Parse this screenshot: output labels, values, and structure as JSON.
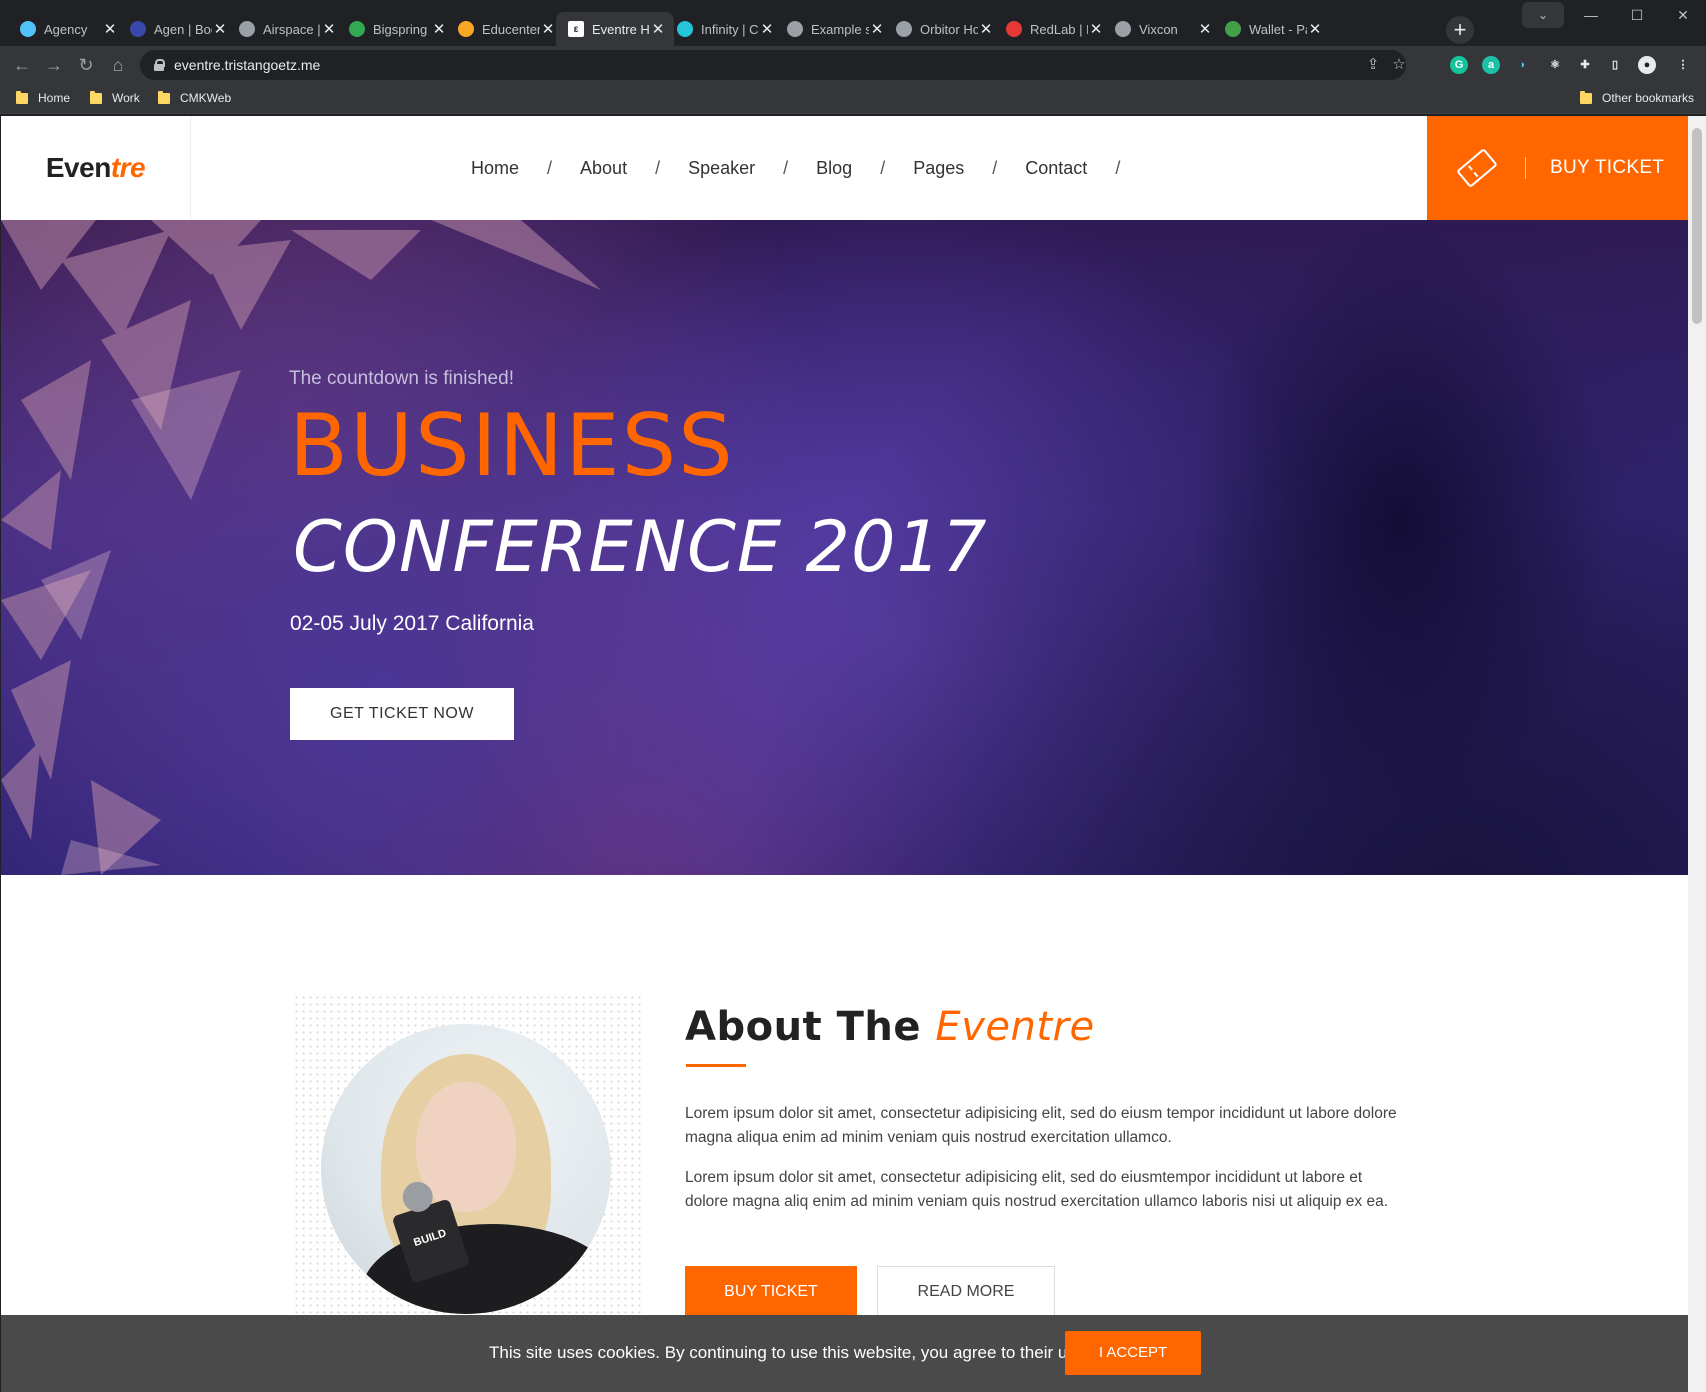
{
  "browser": {
    "tabs": [
      {
        "label": "Agency",
        "icon": "agency-icon",
        "color": "#4fc3f7"
      },
      {
        "label": "Agen | Boo",
        "icon": "map-pin-icon",
        "color": "#3949ab"
      },
      {
        "label": "Airspace |",
        "icon": "globe-icon",
        "color": "#9aa0a6"
      },
      {
        "label": "Bigspring",
        "icon": "bigspring-icon",
        "color": "#34a853"
      },
      {
        "label": "Educenter",
        "icon": "educenter-icon",
        "color": "#f9a825"
      },
      {
        "label": "Eventre Ho",
        "icon": "eventre-favicon",
        "color": "#ffffff"
      },
      {
        "label": "Infinity | C",
        "icon": "infinity-icon",
        "color": "#26c6da"
      },
      {
        "label": "Example s",
        "icon": "chart-line-icon",
        "color": "#9aa0a6"
      },
      {
        "label": "Orbitor Ho",
        "icon": "globe-icon",
        "color": "#9aa0a6"
      },
      {
        "label": "RedLab | B",
        "icon": "redlab-icon",
        "color": "#e53935"
      },
      {
        "label": "Vixcon",
        "icon": "globe-icon",
        "color": "#9aa0a6"
      },
      {
        "label": "Wallet - Pa",
        "icon": "wallet-icon",
        "color": "#43a047"
      }
    ],
    "active_tab": "Eventre Ho",
    "url": "eventre.tristangoetz.me",
    "bookmarks": [
      "Home",
      "Work",
      "CMKWeb"
    ],
    "other_bookmarks": "Other bookmarks"
  },
  "site": {
    "logo": {
      "part1": "Even",
      "part2": "tre"
    },
    "nav": [
      "Home",
      "About",
      "Speaker",
      "Blog",
      "Pages",
      "Contact"
    ],
    "nav_separator": "/",
    "buy_ticket": "BUY TICKET",
    "accent_color": "#ff6600",
    "hero": {
      "countdown": "The countdown is finished!",
      "title1": "BUSINESS",
      "title2": "CONFERENCE 2017",
      "date": "02-05 July 2017 California",
      "cta": "GET TICKET NOW"
    },
    "about": {
      "title_plain": "About The",
      "title_accent": "Eventre",
      "paragraph1": "Lorem ipsum dolor sit amet, consectetur adipisicing elit, sed do eiusm tempor incididunt ut labore dolore magna aliqua enim ad minim veniam quis nostrud exercitation ullamco.",
      "paragraph2": "Lorem ipsum dolor sit amet, consectetur adipisicing elit, sed do eiusmtempor incididunt ut labore et dolore magna aliq enim ad minim veniam quis nostrud exercitation ullamco laboris nisi ut aliquip ex ea.",
      "buy_button": "BUY TICKET",
      "read_more": "READ MORE",
      "mic_label": "BUILD"
    },
    "cookie": {
      "text": "This site uses cookies. By continuing to use this website, you agree to their use.",
      "button": "I ACCEPT"
    }
  }
}
